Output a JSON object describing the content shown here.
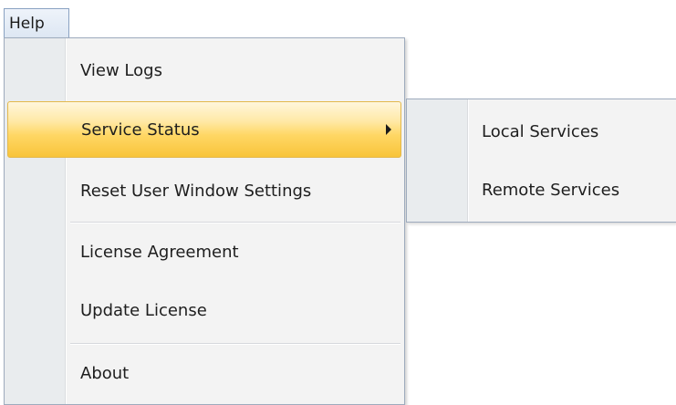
{
  "menubar": {
    "help_label": "Help"
  },
  "help_menu": {
    "items": [
      {
        "label": "View Logs"
      },
      {
        "label": "Service Status"
      },
      {
        "label": "Reset User Window Settings"
      },
      {
        "label": "License Agreement"
      },
      {
        "label": "Update License"
      },
      {
        "label": "About"
      }
    ],
    "highlighted_item": "Service Status"
  },
  "service_status_submenu": {
    "items": [
      {
        "label": "Local Services"
      },
      {
        "label": "Remote Services"
      }
    ]
  },
  "colors": {
    "highlight_top": "#fff6dc",
    "highlight_bottom": "#f8c43a",
    "highlight_border": "#e3b84c",
    "menu_background": "#f3f3f3",
    "menu_border": "#9eabbd"
  }
}
